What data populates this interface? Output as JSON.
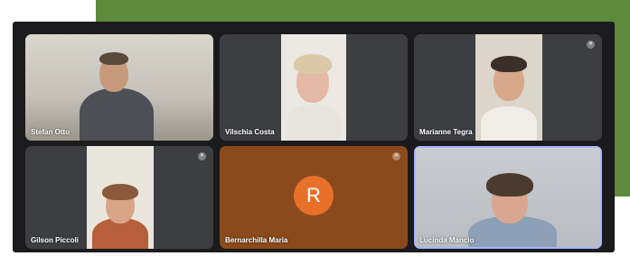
{
  "participants": [
    {
      "name": "Stefan Otto",
      "muted": false
    },
    {
      "name": "Vilschia Costa",
      "muted": false
    },
    {
      "name": "Marianne Tegra",
      "muted": true
    },
    {
      "name": "Gilson Piccoli",
      "muted": true
    },
    {
      "name": "Bernarchilla Maria",
      "muted": true,
      "avatar_letter": "R"
    },
    {
      "name": "Lucinda Mancio",
      "muted": false,
      "active_speaker": true
    }
  ],
  "colors": {
    "frame": "#1b1b1d",
    "tile": "#3c3e42",
    "green_backdrop": "#5e8a3c",
    "avatar_bg": "#e8702a",
    "avatar_tile": "#8a4a1c",
    "speaker_outline": "#aab4ff"
  },
  "icons": {
    "muted": "mic-off-icon"
  }
}
